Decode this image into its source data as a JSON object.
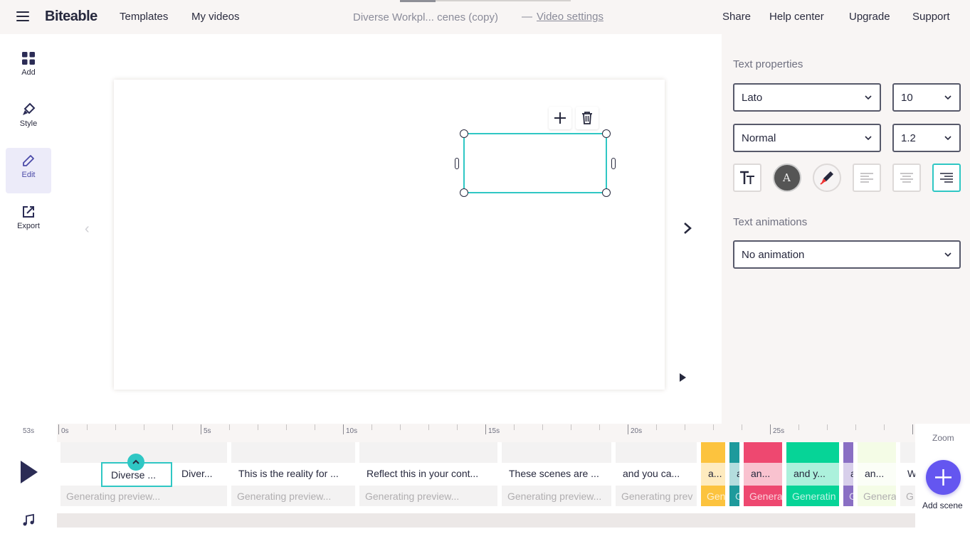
{
  "app": {
    "logo": "Biteable",
    "nav": {
      "templates": "Templates",
      "my_videos": "My videos"
    },
    "project_title": "Diverse Workpl... cenes  (copy)",
    "separator": "—",
    "video_settings": "Video settings",
    "right_nav": {
      "share": "Share",
      "help": "Help center",
      "upgrade": "Upgrade",
      "support": "Support"
    }
  },
  "sidebar": {
    "items": [
      {
        "label": "Add",
        "icon": "grid-icon"
      },
      {
        "label": "Style",
        "icon": "brush-icon"
      },
      {
        "label": "Edit",
        "icon": "pencil-icon",
        "active": true
      },
      {
        "label": "Export",
        "icon": "export-icon"
      }
    ]
  },
  "panel": {
    "text_properties": "Text properties",
    "font": "Lato",
    "size": "10",
    "weight": "Normal",
    "line_height": "1.2",
    "format_buttons": [
      {
        "icon": "text-size-icon"
      },
      {
        "icon": "text-color-icon",
        "letter": "A"
      },
      {
        "icon": "highlight-color-icon"
      },
      {
        "icon": "align-left-icon"
      },
      {
        "icon": "align-center-icon"
      },
      {
        "icon": "align-right-icon",
        "selected": true
      }
    ],
    "text_animations": "Text animations",
    "animation": "No animation"
  },
  "timeline": {
    "duration": "53s",
    "ticks": [
      "0s",
      "5s",
      "10s",
      "15s",
      "20s",
      "25s"
    ],
    "selected_scene": "Diverse ...",
    "scenes": [
      {
        "label": "",
        "gen": "Generating preview...",
        "color": "#f3f2f2"
      },
      {
        "label": "Diver...",
        "gen": "",
        "color": "#f3f2f2"
      },
      {
        "label": "This is the reality for ...",
        "gen": "Generating preview...",
        "color": "#f3f2f2"
      },
      {
        "label": "Reflect this in your cont...",
        "gen": "Generating preview...",
        "color": "#f3f2f2"
      },
      {
        "label": "These scenes are ...",
        "gen": "Generating preview...",
        "color": "#f3f2f2"
      },
      {
        "label": "and you ca...",
        "gen": "Generating prev",
        "color": "#f3f2f2"
      },
      {
        "label": "a...",
        "gen": "Gen",
        "color": "#fcc33e"
      },
      {
        "label": "a",
        "gen": "G",
        "color": "#1e9a9c"
      },
      {
        "label": "an...",
        "gen": "Genera",
        "color": "#ee4870"
      },
      {
        "label": "and y...",
        "gen": "Generatin",
        "color": "#06d497"
      },
      {
        "label": "a",
        "gen": "G",
        "color": "#8a6fc4"
      },
      {
        "label": "an...",
        "gen": "Genera",
        "color": "#f4fce6"
      },
      {
        "label": "W",
        "gen": "G",
        "color": "#f3f2f2"
      }
    ],
    "zoom": "Zoom",
    "add_scene": "Add scene"
  },
  "colors": {
    "accent": "#2fc7c4",
    "primary": "#6456f0",
    "dark": "#26283d"
  }
}
